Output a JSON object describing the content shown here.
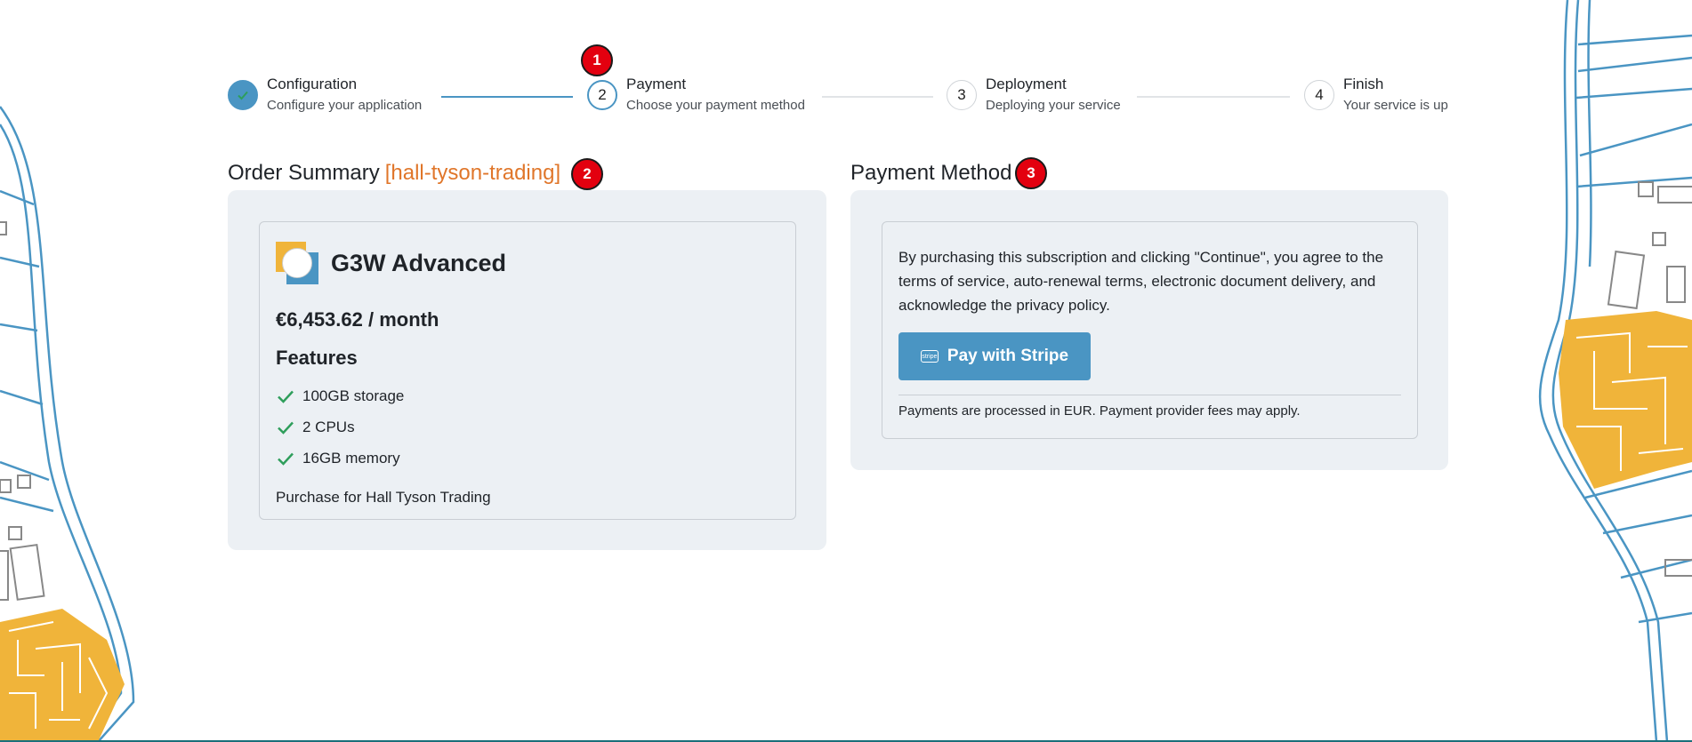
{
  "stepper": {
    "steps": [
      {
        "number": "",
        "title": "Configuration",
        "subtitle": "Configure your application"
      },
      {
        "number": "2",
        "title": "Payment",
        "subtitle": "Choose your payment method"
      },
      {
        "number": "3",
        "title": "Deployment",
        "subtitle": "Deploying your service"
      },
      {
        "number": "4",
        "title": "Finish",
        "subtitle": "Your service is up"
      }
    ]
  },
  "annotations": {
    "one": "1",
    "two": "2",
    "three": "3"
  },
  "order_summary": {
    "heading": "Order Summary",
    "org_tag": "[hall-tyson-trading]",
    "product_name": "G3W Advanced",
    "price": "€6,453.62 / month",
    "features_title": "Features",
    "features": [
      "100GB storage",
      "2 CPUs",
      "16GB memory"
    ],
    "purchase_for": "Purchase for Hall Tyson Trading"
  },
  "payment_method": {
    "heading": "Payment Method",
    "terms": "By purchasing this subscription and clicking \"Continue\", you agree to the terms of service, auto-renewal terms, electronic document delivery, and acknowledge the privacy policy.",
    "button_label": "Pay with Stripe",
    "note": "Payments are processed in EUR. Payment provider fees may apply."
  },
  "colors": {
    "accent": "#4a95c3",
    "org_tag": "#e0762a",
    "badge": "#e3000f",
    "check": "#2e9e5b"
  }
}
